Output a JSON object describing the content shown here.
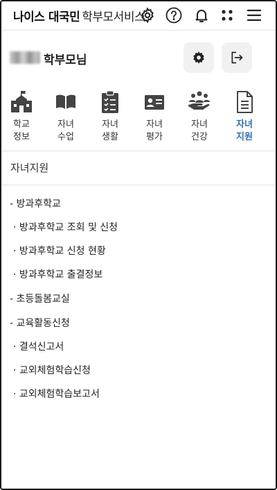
{
  "header": {
    "brand_main": "나이스 대국민",
    "brand_sub": "학부모서비스",
    "icons": [
      "gear-icon",
      "help-icon",
      "bell-icon",
      "apps-icon",
      "menu-icon"
    ]
  },
  "profile": {
    "name_suffix": "학부모님",
    "buttons": [
      "settings-gear-icon",
      "logout-icon"
    ]
  },
  "menu": {
    "items": [
      {
        "icon": "school-icon",
        "label": "학교\n정보",
        "active": false
      },
      {
        "icon": "book-icon",
        "label": "자녀\n수업",
        "active": false
      },
      {
        "icon": "clipboard-icon",
        "label": "자녀\n생활",
        "active": false
      },
      {
        "icon": "id-card-icon",
        "label": "자녀\n평가",
        "active": false
      },
      {
        "icon": "health-care-icon",
        "label": "자녀\n건강",
        "active": false
      },
      {
        "icon": "document-icon",
        "label": "자녀\n지원",
        "active": true
      }
    ],
    "active_color": "#2e6fb8"
  },
  "section": {
    "title": "자녀지원"
  },
  "tree": [
    {
      "label": "- 방과후학교",
      "level": 0
    },
    {
      "label": "· 방과후학교 조회 및 신청",
      "level": 1
    },
    {
      "label": "· 방과후학교 신청 현황",
      "level": 1
    },
    {
      "label": "· 방과후학교 출결정보",
      "level": 1
    },
    {
      "label": "- 초등돌봄교실",
      "level": 0
    },
    {
      "label": "- 교육활동신청",
      "level": 0
    },
    {
      "label": "· 결석신고서",
      "level": 1
    },
    {
      "label": "· 교외체험학습신청",
      "level": 1
    },
    {
      "label": "· 교외체험학습보고서",
      "level": 1
    }
  ]
}
